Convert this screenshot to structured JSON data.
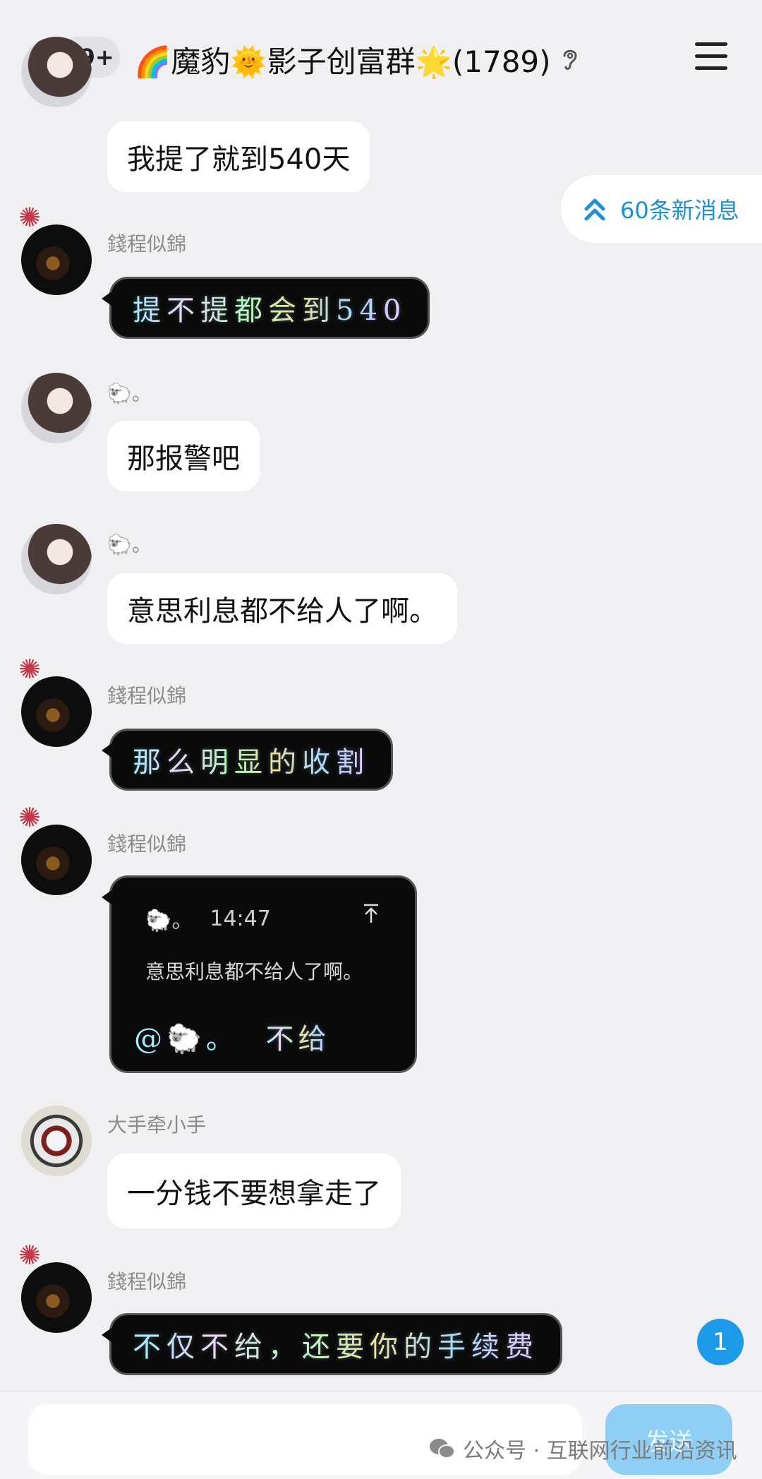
{
  "header": {
    "unread_badge": "99+",
    "group_title": "🌈魔豹🌞影子创富群🌟(1789)"
  },
  "new_messages_pill": "60条新消息",
  "messages": [
    {
      "text": "我提了就到540天"
    },
    {
      "nick": "錢程似錦",
      "text": "提不提都会到540"
    },
    {
      "nick": "🐑。",
      "text": "那报警吧"
    },
    {
      "nick": "🐑。",
      "text": "意思利息都不给人了啊。"
    },
    {
      "nick": "錢程似錦",
      "text": "那么明显的收割"
    },
    {
      "nick": "錢程似錦",
      "quote": {
        "sender": "🐑。",
        "time": "14:47",
        "text": "意思利息都不给人了啊。"
      },
      "reply_at": "@🐑。",
      "reply_text": "不给"
    },
    {
      "nick": "大手牵小手",
      "text": "一分钱不要想拿走了"
    },
    {
      "nick": "錢程似錦",
      "text": "不仅不给，还要你的手续费"
    }
  ],
  "unread_count": "1",
  "composer": {
    "send_label": "发送"
  },
  "watermark": "公众号 · 互联网行业前沿资讯"
}
